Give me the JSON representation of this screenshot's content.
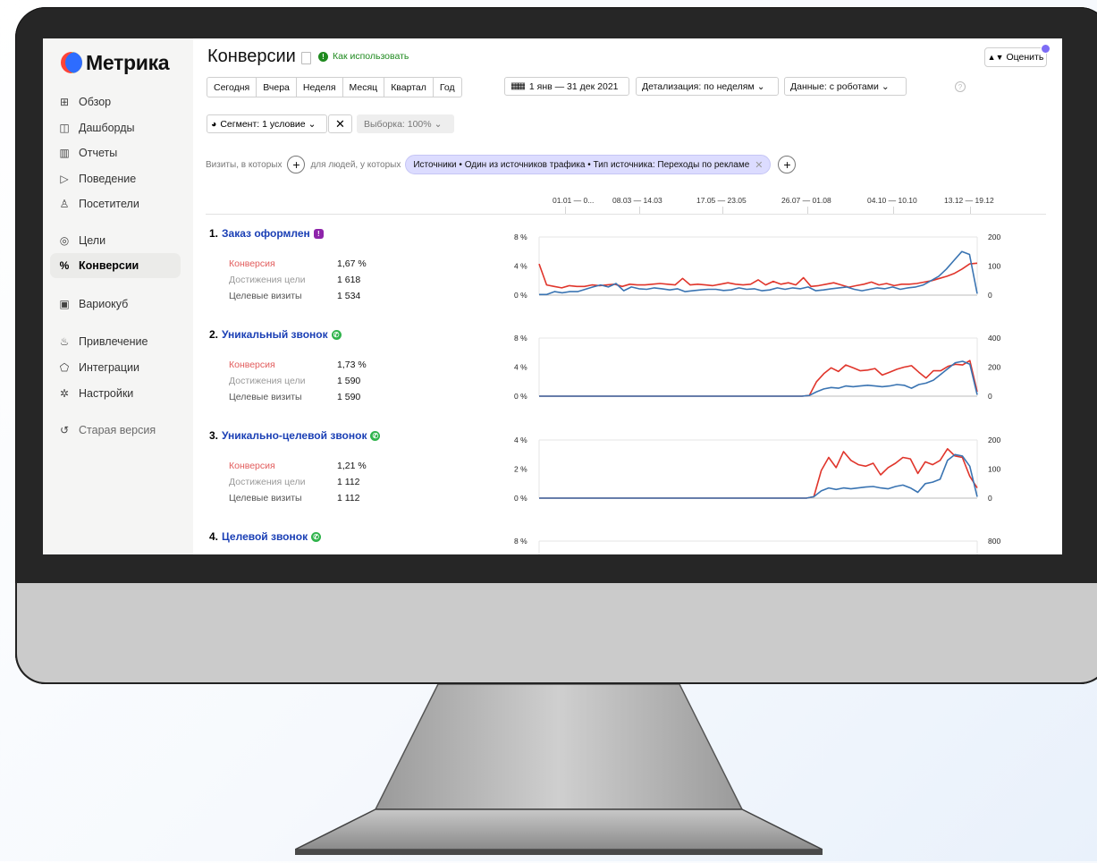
{
  "app": {
    "logo_text": "Метрика",
    "colors": {
      "accent_blue": "#1a3fb5",
      "conversion_red": "#e25c5c",
      "line_red": "#e0352b",
      "line_blue": "#3a74b2",
      "segment_chip": "#dcdcff"
    }
  },
  "sidebar": {
    "items": [
      {
        "label": "Обзор",
        "icon": "grid-icon",
        "glyph": "⊞"
      },
      {
        "label": "Дашборды",
        "icon": "dashboard-icon",
        "glyph": "◫"
      },
      {
        "label": "Отчеты",
        "icon": "bar-chart-icon",
        "glyph": "▥"
      },
      {
        "label": "Поведение",
        "icon": "play-icon",
        "glyph": "▷"
      },
      {
        "label": "Посетители",
        "icon": "person-icon",
        "glyph": "♙"
      },
      {
        "label": "Цели",
        "icon": "target-icon",
        "glyph": "◎"
      },
      {
        "label": "Конверсии",
        "icon": "percent-icon",
        "glyph": "%"
      },
      {
        "label": "Вариокуб",
        "icon": "cube-icon",
        "glyph": "▣"
      },
      {
        "label": "Привлечение",
        "icon": "fire-icon",
        "glyph": "♨"
      },
      {
        "label": "Интеграции",
        "icon": "puzzle-icon",
        "glyph": "⬠"
      },
      {
        "label": "Настройки",
        "icon": "gear-icon",
        "glyph": "✲"
      },
      {
        "label": "Старая версия",
        "icon": "undo-icon",
        "glyph": "↺"
      }
    ],
    "active_label": "Конверсии"
  },
  "header": {
    "title": "Конверсии",
    "howto_label": "Как использовать",
    "rate_label": "Оценить"
  },
  "toolbar": {
    "periods": [
      "Сегодня",
      "Вчера",
      "Неделя",
      "Месяц",
      "Квартал",
      "Год"
    ],
    "date_range": "1 янв — 31 дек 2021",
    "detail": "Детализация: по неделям",
    "data_mode": "Данные: с роботами",
    "segment": "Сегмент: 1 условие",
    "sample": "Выборка: 100%"
  },
  "filter": {
    "prefix": "Визиты, в которых",
    "middle": "для людей, у которых",
    "chip": "Источники • Один из источников трафика • Тип источника: Переходы по рекламе"
  },
  "timeline": {
    "labels": [
      "01.01 — 0...",
      "08.03 — 14.03",
      "17.05 — 23.05",
      "26.07 — 01.08",
      "04.10 — 10.10",
      "13.12 — 19.12"
    ]
  },
  "metric_labels": {
    "conversion": "Конверсия",
    "reaches": "Достижения цели",
    "visits": "Целевые визиты"
  },
  "goals": [
    {
      "num": "1.",
      "name": "Заказ оформлен",
      "icon": "exclamation-icon",
      "conversion": "1,67 %",
      "reaches": "1 618",
      "visits": "1 534"
    },
    {
      "num": "2.",
      "name": "Уникальный звонок",
      "icon": "phone-icon",
      "conversion": "1,73 %",
      "reaches": "1 590",
      "visits": "1 590"
    },
    {
      "num": "3.",
      "name": "Уникально-целевой звонок",
      "icon": "phone-icon",
      "conversion": "1,21 %",
      "reaches": "1 112",
      "visits": "1 112"
    },
    {
      "num": "4.",
      "name": "Целевой звонок",
      "icon": "phone-icon"
    }
  ],
  "chart_data": [
    {
      "type": "line",
      "title": "Заказ оформлен",
      "x_count": 52,
      "y_left_ticks": [
        "0 %",
        "4 %",
        "8 %"
      ],
      "y_left_lim": [
        0,
        8
      ],
      "y_right_ticks": [
        "0",
        "100",
        "200"
      ],
      "y_right_lim": [
        0,
        200
      ],
      "series": [
        {
          "color": "#e0352b",
          "axis": "left",
          "values": [
            4.3,
            1.4,
            1.2,
            1.0,
            1.3,
            1.2,
            1.2,
            1.4,
            1.3,
            1.4,
            1.5,
            1.2,
            1.5,
            1.4,
            1.4,
            1.5,
            1.6,
            1.5,
            1.4,
            2.3,
            1.4,
            1.5,
            1.4,
            1.3,
            1.5,
            1.7,
            1.5,
            1.4,
            1.5,
            2.1,
            1.4,
            1.9,
            1.5,
            1.7,
            1.4,
            2.4,
            1.2,
            1.3,
            1.5,
            1.7,
            1.4,
            1.1,
            1.3,
            1.5,
            1.8,
            1.4,
            1.6,
            1.3,
            1.5,
            1.5,
            1.6,
            1.8,
            2.0,
            2.3,
            2.6,
            3.0,
            3.6,
            4.3,
            4.4
          ]
        },
        {
          "color": "#3a74b2",
          "axis": "right",
          "values": [
            2,
            2,
            12,
            8,
            12,
            12,
            20,
            28,
            35,
            28,
            40,
            15,
            28,
            22,
            20,
            25,
            22,
            18,
            22,
            12,
            15,
            18,
            20,
            20,
            16,
            18,
            25,
            20,
            22,
            15,
            18,
            25,
            20,
            25,
            22,
            28,
            15,
            18,
            22,
            25,
            28,
            20,
            15,
            20,
            25,
            22,
            28,
            20,
            25,
            28,
            35,
            50,
            65,
            90,
            120,
            150,
            140,
            5
          ]
        }
      ]
    },
    {
      "type": "line",
      "title": "Уникальный звонок",
      "x_count": 52,
      "y_left_ticks": [
        "0 %",
        "4 %",
        "8 %"
      ],
      "y_left_lim": [
        0,
        8
      ],
      "y_right_ticks": [
        "0",
        "200",
        "400"
      ],
      "y_right_lim": [
        0,
        400
      ],
      "series": [
        {
          "color": "#e0352b",
          "axis": "left",
          "values": [
            0,
            0,
            0,
            0,
            0,
            0,
            0,
            0,
            0,
            0,
            0,
            0,
            0,
            0,
            0,
            0,
            0,
            0,
            0,
            0,
            0,
            0,
            0,
            0,
            0,
            0,
            0,
            0,
            0,
            0,
            0,
            0,
            0,
            0,
            0,
            0,
            0,
            0.1,
            2.0,
            3.1,
            3.9,
            3.4,
            4.3,
            3.9,
            3.5,
            3.6,
            3.8,
            2.9,
            3.3,
            3.7,
            4.0,
            4.2,
            3.3,
            2.5,
            3.5,
            3.5,
            4.1,
            4.4,
            4.3,
            4.9,
            0.6
          ]
        },
        {
          "color": "#3a74b2",
          "axis": "right",
          "values": [
            0,
            0,
            0,
            0,
            0,
            0,
            0,
            0,
            0,
            0,
            0,
            0,
            0,
            0,
            0,
            0,
            0,
            0,
            0,
            0,
            0,
            0,
            0,
            0,
            0,
            0,
            0,
            0,
            0,
            0,
            0,
            0,
            0,
            0,
            0,
            0,
            0,
            5,
            30,
            50,
            60,
            55,
            70,
            65,
            70,
            75,
            70,
            65,
            70,
            80,
            75,
            55,
            80,
            90,
            110,
            150,
            190,
            230,
            240,
            220,
            10
          ]
        }
      ]
    },
    {
      "type": "line",
      "title": "Уникально-целевой звонок",
      "x_count": 52,
      "y_left_ticks": [
        "0 %",
        "2 %",
        "4 %"
      ],
      "y_left_lim": [
        0,
        4
      ],
      "y_right_ticks": [
        "0",
        "100",
        "200"
      ],
      "y_right_lim": [
        0,
        200
      ],
      "series": [
        {
          "color": "#e0352b",
          "axis": "left",
          "values": [
            0,
            0,
            0,
            0,
            0,
            0,
            0,
            0,
            0,
            0,
            0,
            0,
            0,
            0,
            0,
            0,
            0,
            0,
            0,
            0,
            0,
            0,
            0,
            0,
            0,
            0,
            0,
            0,
            0,
            0,
            0,
            0,
            0,
            0,
            0,
            0,
            0,
            0.1,
            1.9,
            2.8,
            2.1,
            3.2,
            2.6,
            2.3,
            2.2,
            2.4,
            1.6,
            2.1,
            2.4,
            2.8,
            2.7,
            1.7,
            2.5,
            2.3,
            2.6,
            3.4,
            2.9,
            2.8,
            1.5,
            0.7
          ]
        },
        {
          "color": "#3a74b2",
          "axis": "right",
          "values": [
            0,
            0,
            0,
            0,
            0,
            0,
            0,
            0,
            0,
            0,
            0,
            0,
            0,
            0,
            0,
            0,
            0,
            0,
            0,
            0,
            0,
            0,
            0,
            0,
            0,
            0,
            0,
            0,
            0,
            0,
            0,
            0,
            0,
            0,
            0,
            0,
            0,
            5,
            25,
            35,
            30,
            35,
            32,
            35,
            38,
            40,
            35,
            32,
            40,
            45,
            35,
            20,
            50,
            55,
            65,
            130,
            150,
            145,
            110,
            5
          ]
        }
      ]
    },
    {
      "type": "line",
      "title": "Целевой звонок",
      "x_count": 52,
      "y_left_ticks": [
        "8 %"
      ],
      "y_left_lim": [
        0,
        8
      ],
      "y_right_ticks": [
        "800"
      ],
      "y_right_lim": [
        0,
        800
      ],
      "series": []
    }
  ]
}
